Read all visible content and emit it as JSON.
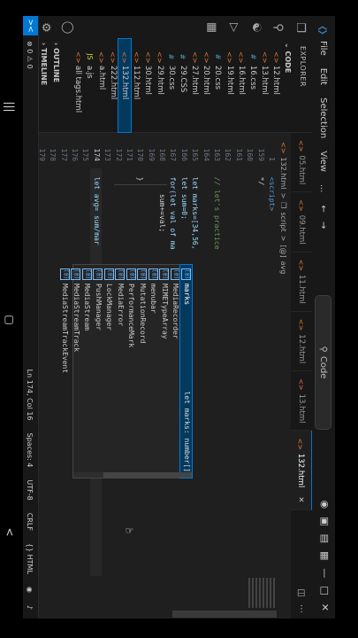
{
  "titlebar": {
    "menu": [
      "File",
      "Edit",
      "Selection",
      "View",
      "..."
    ],
    "search_text": "Code",
    "logo_icon": "vscode-logo"
  },
  "sidebar": {
    "header": "EXPLORER",
    "folder": "CODE",
    "files": [
      {
        "name": "12.html",
        "type": "html"
      },
      {
        "name": "13.html",
        "type": "html"
      },
      {
        "name": "16.css",
        "type": "css"
      },
      {
        "name": "16.html",
        "type": "html"
      },
      {
        "name": "19.html",
        "type": "html"
      },
      {
        "name": "20.css",
        "type": "css"
      },
      {
        "name": "20.html",
        "type": "html"
      },
      {
        "name": "27.html",
        "type": "html"
      },
      {
        "name": "29.CSS",
        "type": "css"
      },
      {
        "name": "30.css",
        "type": "css"
      },
      {
        "name": "29.html",
        "type": "html"
      },
      {
        "name": "30.html",
        "type": "html"
      },
      {
        "name": "112.html",
        "type": "html"
      },
      {
        "name": "132.html",
        "type": "html",
        "active": true
      },
      {
        "name": "222.html",
        "type": "html"
      },
      {
        "name": "a.html",
        "type": "html"
      },
      {
        "name": "a.js",
        "type": "js"
      },
      {
        "name": "all tags.html",
        "type": "html"
      }
    ],
    "outline": "OUTLINE",
    "timeline": "TIMELINE"
  },
  "tabs": [
    {
      "label": "05.html",
      "active": false
    },
    {
      "label": "09.html",
      "active": false
    },
    {
      "label": "11.html",
      "active": false
    },
    {
      "label": "12.html",
      "active": false
    },
    {
      "label": "13.html",
      "active": false
    },
    {
      "label": "132.html",
      "active": true
    }
  ],
  "breadcrumb": {
    "file": "132.html",
    "sep1": ">",
    "script": "script",
    "sep2": ">",
    "symbol": "avg"
  },
  "editor": {
    "line_numbers": [
      "1",
      "159",
      "160",
      "161",
      "162",
      "163",
      "164",
      "165",
      "166",
      "167",
      "168",
      "169",
      "170",
      "171",
      "172",
      "173",
      "174",
      "175",
      "176",
      "177",
      "178",
      "179",
      "180"
    ],
    "current_line": "174",
    "lines": [
      "  <script>",
      "  */",
      "",
      "",
      "",
      "  // let's practice",
      "",
      "  let marks=[34,56,",
      "  let sum=0;",
      "  for(let val of ma",
      "      sum+=val;",
      "",
      "  }",
      "",
      "",
      "",
      "  let avg= sum/mar",
      "",
      "",
      "",
      "",
      "",
      ""
    ]
  },
  "suggest": {
    "items": [
      {
        "label": "marks",
        "match": "mar",
        "detail": "let marks: number[]",
        "selected": true
      },
      {
        "label": "MediaRecorder",
        "selected": false
      },
      {
        "label": "MIMETypeArray",
        "selected": false
      },
      {
        "label": "menubar",
        "selected": false
      },
      {
        "label": "MutationRecord",
        "selected": false
      },
      {
        "label": "PerformanceMark",
        "selected": false
      },
      {
        "label": "MediaError",
        "selected": false
      },
      {
        "label": "LockManager",
        "selected": false
      },
      {
        "label": "PushManager",
        "selected": false
      },
      {
        "label": "MediaStream",
        "selected": false
      },
      {
        "label": "MediaStreamTrack",
        "selected": false
      },
      {
        "label": "MediaStreamTrackEvent",
        "selected": false
      }
    ],
    "kind_icon": "[@]"
  },
  "status": {
    "errors": "⊗ 0 ⚠ 0",
    "ln_col": "Ln 174, Col 16",
    "spaces": "Spaces: 4",
    "encoding": "UTF-8",
    "eol": "CRLF",
    "language": "{} HTML",
    "bell_icon": "bell-icon"
  },
  "colors": {
    "accent": "#0078d4",
    "background": "#1e1e1e",
    "keyword": "#569cd6",
    "comment": "#6a9955",
    "html_icon": "#e37933"
  }
}
